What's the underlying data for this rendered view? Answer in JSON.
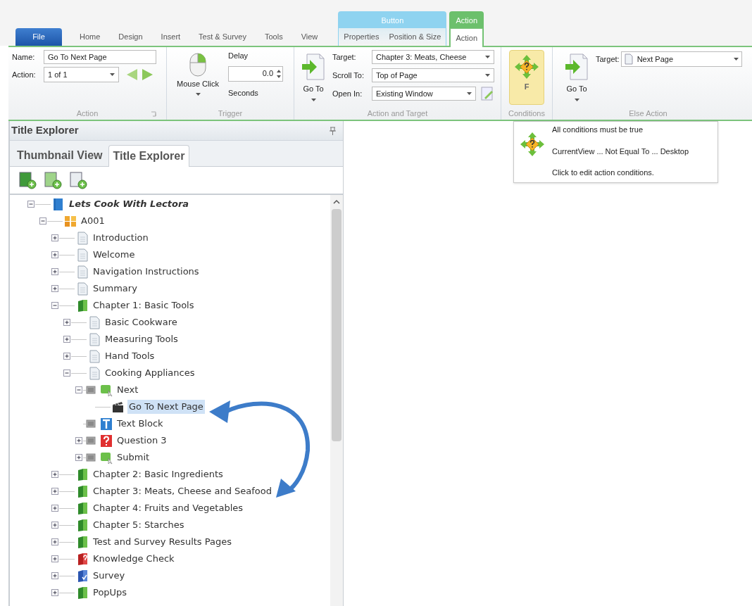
{
  "tabs": [
    {
      "label": "File",
      "kind": "file",
      "selected": false
    },
    {
      "label": "Home",
      "kind": "plain",
      "selected": false
    },
    {
      "label": "Design",
      "kind": "plain",
      "selected": false
    },
    {
      "label": "Insert",
      "kind": "plain",
      "selected": false
    },
    {
      "label": "Test & Survey",
      "kind": "plain",
      "selected": false
    },
    {
      "label": "Tools",
      "kind": "plain",
      "selected": false
    },
    {
      "label": "View",
      "kind": "plain",
      "selected": false
    }
  ],
  "context_tabs": [
    {
      "label": "Button",
      "color": "#8fd3f0",
      "tabs": [
        {
          "label": "Properties",
          "selected": false
        },
        {
          "label": "Position & Size",
          "selected": false
        }
      ]
    },
    {
      "label": "Action",
      "color": "#6cc06c",
      "tabs": [
        {
          "label": "Action",
          "selected": true
        }
      ]
    }
  ],
  "action_group": {
    "label": "Action",
    "name_label": "Name:",
    "name_value": "Go To Next Page",
    "action_label": "Action:",
    "action_value": "1 of 1"
  },
  "trigger_group": {
    "label": "Trigger",
    "button": "Mouse Click",
    "delay_label": "Delay",
    "delay_value": "0.0",
    "seconds_label": "Seconds"
  },
  "target_group": {
    "label": "Action and Target",
    "button": "Go To",
    "fields": [
      {
        "label": "Target:",
        "value": "Chapter 3: Meats, Cheese"
      },
      {
        "label": "Scroll To:",
        "value": "Top of Page"
      },
      {
        "label": "Open In:",
        "value": "Existing Window"
      }
    ]
  },
  "conditions_group": {
    "label": "Conditions",
    "button": "F"
  },
  "else_group": {
    "label": "Else Action",
    "button": "Go To",
    "target_label": "Target:",
    "target_value": "Next Page"
  },
  "tooltip": {
    "lines": [
      "All conditions must be true",
      "CurrentView ... Not Equal To ... Desktop",
      "Click to edit action conditions."
    ]
  },
  "panel": {
    "title": "Title Explorer",
    "tabs": [
      {
        "label": "Thumbnail View",
        "selected": false
      },
      {
        "label": "Title Explorer",
        "selected": true
      }
    ],
    "tree": [
      {
        "label": "Lets Cook With Lectora",
        "kind": "title",
        "expanded": true,
        "selected": false,
        "children": [
          {
            "label": "A001",
            "kind": "folder",
            "expanded": true,
            "selected": false,
            "children": [
              {
                "label": "Introduction",
                "kind": "page",
                "expanded": false,
                "selected": false
              },
              {
                "label": "Welcome",
                "kind": "page",
                "expanded": false,
                "selected": false
              },
              {
                "label": "Navigation Instructions",
                "kind": "page",
                "expanded": false,
                "selected": false
              },
              {
                "label": "Summary",
                "kind": "page",
                "expanded": false,
                "selected": false
              },
              {
                "label": "Chapter 1: Basic Tools",
                "kind": "chapter",
                "expanded": true,
                "selected": false,
                "children": [
                  {
                    "label": "Basic Cookware",
                    "kind": "page",
                    "expanded": false,
                    "selected": false
                  },
                  {
                    "label": "Measuring Tools",
                    "kind": "page",
                    "expanded": false,
                    "selected": false
                  },
                  {
                    "label": "Hand Tools",
                    "kind": "page",
                    "expanded": false,
                    "selected": false
                  },
                  {
                    "label": "Cooking Appliances",
                    "kind": "page",
                    "expanded": true,
                    "selected": false,
                    "children": [
                      {
                        "label": "Next",
                        "kind": "button",
                        "expanded": true,
                        "selected": false,
                        "children": [
                          {
                            "label": "Go To Next Page",
                            "kind": "action",
                            "selected": true
                          }
                        ]
                      },
                      {
                        "label": "Text Block",
                        "kind": "text",
                        "selected": false
                      },
                      {
                        "label": "Question 3",
                        "kind": "question",
                        "expanded": false,
                        "selected": false
                      },
                      {
                        "label": "Submit",
                        "kind": "button",
                        "expanded": false,
                        "selected": false
                      }
                    ]
                  }
                ]
              },
              {
                "label": "Chapter 2: Basic Ingredients",
                "kind": "chapter",
                "expanded": false,
                "selected": false
              },
              {
                "label": "Chapter 3: Meats, Cheese and Seafood",
                "kind": "chapter",
                "expanded": false,
                "selected": false
              },
              {
                "label": "Chapter 4: Fruits and Vegetables",
                "kind": "chapter",
                "expanded": false,
                "selected": false
              },
              {
                "label": "Chapter 5: Starches",
                "kind": "chapter",
                "expanded": false,
                "selected": false
              },
              {
                "label": "Test and Survey Results Pages",
                "kind": "chapter",
                "expanded": false,
                "selected": false
              },
              {
                "label": "Knowledge Check",
                "kind": "test",
                "expanded": false,
                "selected": false
              },
              {
                "label": "Survey",
                "kind": "survey",
                "expanded": false,
                "selected": false
              },
              {
                "label": "PopUps",
                "kind": "chapter",
                "expanded": false,
                "selected": false
              }
            ]
          }
        ]
      }
    ]
  }
}
